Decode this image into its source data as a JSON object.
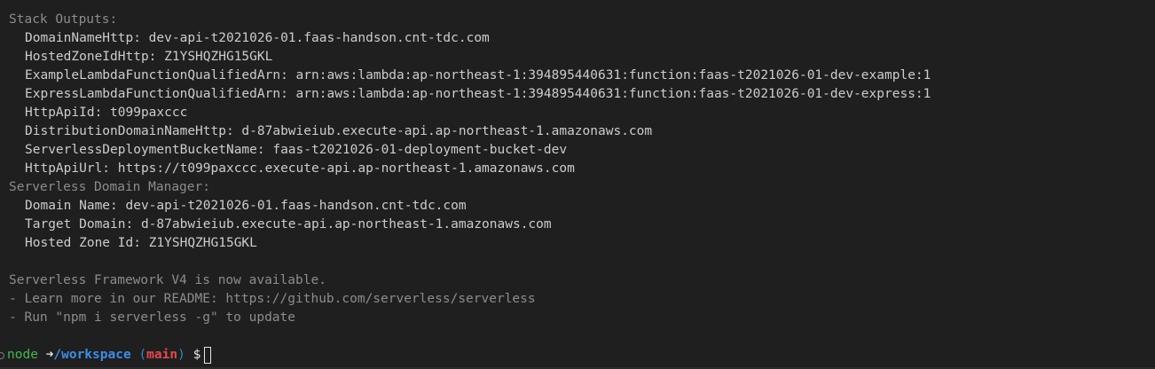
{
  "stack_outputs": {
    "header": "Stack Outputs:",
    "items": [
      "DomainNameHttp: dev-api-t2021026-01.faas-handson.cnt-tdc.com",
      "HostedZoneIdHttp: Z1YSHQZHG15GKL",
      "ExampleLambdaFunctionQualifiedArn: arn:aws:lambda:ap-northeast-1:394895440631:function:faas-t2021026-01-dev-example:1",
      "ExpressLambdaFunctionQualifiedArn: arn:aws:lambda:ap-northeast-1:394895440631:function:faas-t2021026-01-dev-express:1",
      "HttpApiId: t099paxccc",
      "DistributionDomainNameHttp: d-87abwieiub.execute-api.ap-northeast-1.amazonaws.com",
      "ServerlessDeploymentBucketName: faas-t2021026-01-deployment-bucket-dev",
      "HttpApiUrl: https://t099paxccc.execute-api.ap-northeast-1.amazonaws.com"
    ]
  },
  "domain_manager": {
    "header": "Serverless Domain Manager:",
    "items": [
      "Domain Name: dev-api-t2021026-01.faas-handson.cnt-tdc.com",
      "Target Domain: d-87abwieiub.execute-api.ap-northeast-1.amazonaws.com",
      "Hosted Zone Id: Z1YSHQZHG15GKL"
    ]
  },
  "notice": {
    "lines": [
      "Serverless Framework V4 is now available.",
      "- Learn more in our README: https://github.com/serverless/serverless",
      "- Run \"npm i serverless -g\" to update"
    ]
  },
  "prompt": {
    "user": "node",
    "arrow": "➜",
    "directory": "/workspace",
    "branch_open": "(",
    "branch": "main",
    "branch_close": ")",
    "symbol": "$"
  },
  "colors": {
    "background": "#1f1f1f",
    "text": "#cccccc",
    "dim_text": "#8c8c8c",
    "prompt_user": "#3fb950",
    "prompt_dir": "#3b8eea",
    "prompt_branch": "#e5484d"
  }
}
